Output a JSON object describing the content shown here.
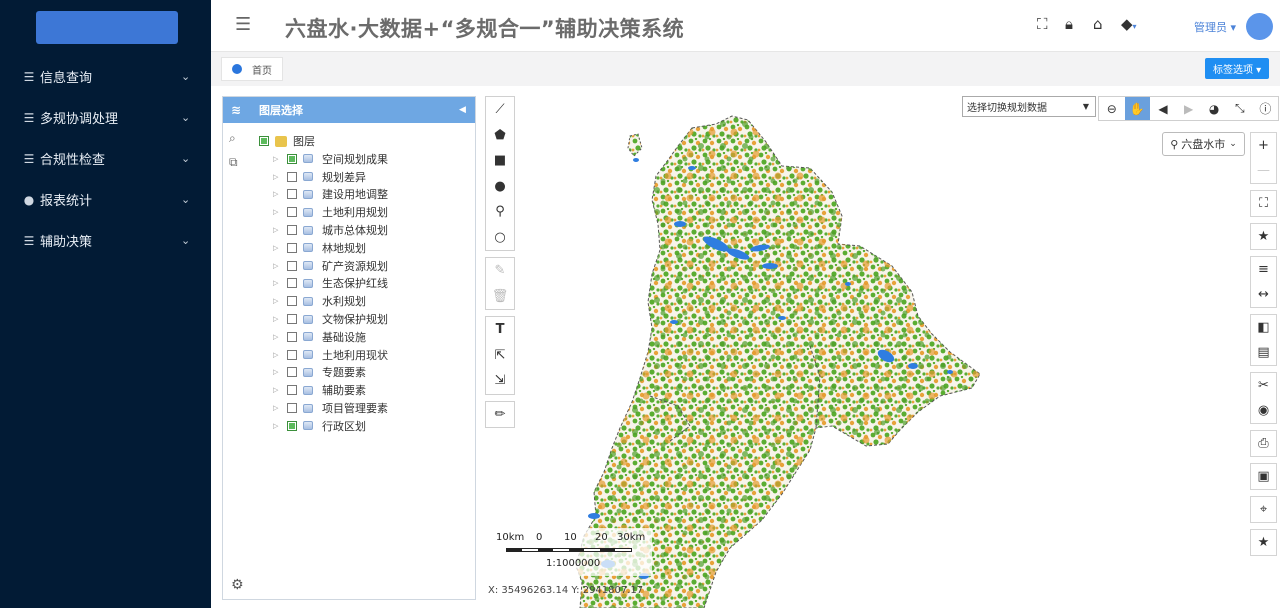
{
  "sidebar": {
    "items": [
      {
        "icon": "list-icon",
        "glyph": "☰",
        "label": "信息查询"
      },
      {
        "icon": "list-icon",
        "glyph": "☰",
        "label": "多规协调处理"
      },
      {
        "icon": "list-icon",
        "glyph": "☰",
        "label": "合规性检查"
      },
      {
        "icon": "pie-chart-icon",
        "glyph": "●",
        "label": "报表统计"
      },
      {
        "icon": "list-icon",
        "glyph": "☰",
        "label": "辅助决策"
      }
    ]
  },
  "header": {
    "title": "六盘水·大数据+“多规合一”辅助决策系统",
    "admin_label": "管理员 ▾"
  },
  "tabs": {
    "home_label": "首页",
    "options_label": "标签选项 ▾"
  },
  "layer_panel": {
    "title": "图层选择",
    "root_label": "图层",
    "layers": [
      {
        "label": "空间规划成果",
        "checked": true
      },
      {
        "label": "规划差异",
        "checked": false
      },
      {
        "label": "建设用地调整",
        "checked": false
      },
      {
        "label": "土地利用规划",
        "checked": false
      },
      {
        "label": "城市总体规划",
        "checked": false
      },
      {
        "label": "林地规划",
        "checked": false
      },
      {
        "label": "矿产资源规划",
        "checked": false
      },
      {
        "label": "生态保护红线",
        "checked": false
      },
      {
        "label": "水利规划",
        "checked": false
      },
      {
        "label": "文物保护规划",
        "checked": false
      },
      {
        "label": "基础设施",
        "checked": false
      },
      {
        "label": "土地利用现状",
        "checked": false
      },
      {
        "label": "专题要素",
        "checked": false
      },
      {
        "label": "辅助要素",
        "checked": false
      },
      {
        "label": "项目管理要素",
        "checked": false
      },
      {
        "label": "行政区划",
        "checked": true
      }
    ]
  },
  "map": {
    "switch_placeholder": "选择切换规划数据",
    "region_label": "六盘水市",
    "scale_labels": [
      "10km",
      "0",
      "10",
      "20",
      "30km"
    ],
    "scale_ratio": "1:1000000",
    "coordinates": "X: 35496263.14 Y: 2941807.17",
    "colors": {
      "green": "#5aad32",
      "orange": "#e8a23a",
      "blue": "#2f7de0",
      "boundary": "#555555"
    }
  }
}
